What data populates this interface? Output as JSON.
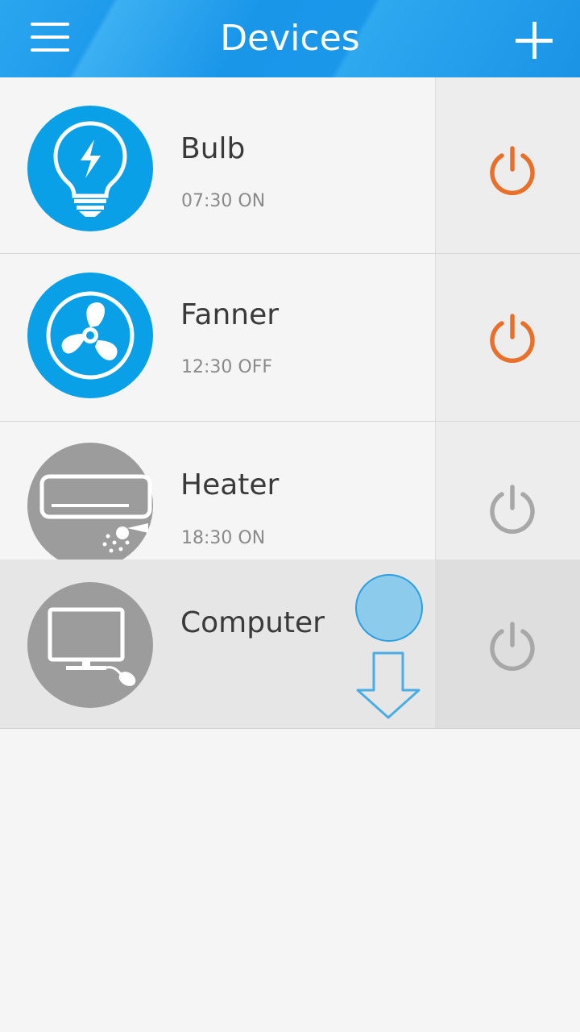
{
  "header": {
    "title": "Devices",
    "menu_icon": "hamburger-menu-icon",
    "add_icon": "plus-icon"
  },
  "devices": [
    {
      "name": "Bulb",
      "schedule": "07:30 ON",
      "icon": "bulb-icon",
      "enabled": true,
      "power_color": "#e8702a"
    },
    {
      "name": "Fanner",
      "schedule": "12:30 OFF",
      "icon": "fan-icon",
      "enabled": true,
      "power_color": "#e8702a"
    },
    {
      "name": "Heater",
      "schedule": "18:30 ON",
      "icon": "air-conditioner-icon",
      "enabled": false,
      "power_color": "#a8a8a8"
    },
    {
      "name": "Computer",
      "schedule": "",
      "icon": "computer-icon",
      "enabled": false,
      "power_color": "#a8a8a8"
    }
  ],
  "colors": {
    "header": "#1a96e9",
    "active_icon_bg": "#0aa0e8",
    "inactive_icon_bg": "#9c9c9c",
    "power_on": "#e8702a",
    "power_off": "#a8a8a8"
  },
  "gesture": {
    "type": "swipe-down",
    "indicator": "touch-point"
  }
}
